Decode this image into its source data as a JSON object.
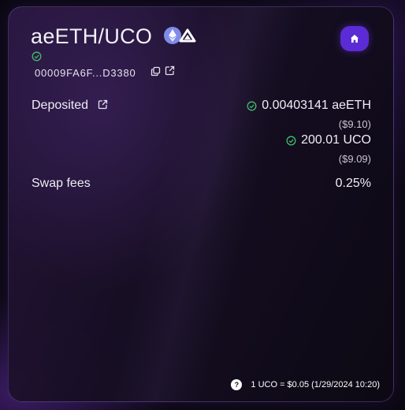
{
  "pool": {
    "title": "aeETH/UCO",
    "address": "00009FA6F...D3380",
    "token_icons": [
      "ethereum-icon",
      "archethic-uco-icon"
    ]
  },
  "nav": {
    "home_icon": "home-icon"
  },
  "deposited": {
    "label": "Deposited",
    "token1_amount": "0.00403141 aeETH",
    "token1_usd": "($9.10)",
    "token2_amount": "200.01 UCO",
    "token2_usd": "($9.09)"
  },
  "swap_fees": {
    "label": "Swap fees",
    "value": "0.25%"
  },
  "footer": {
    "help_symbol": "?",
    "price_text": "1 UCO = $0.05 (1/29/2024 10:20)"
  },
  "colors": {
    "accent": "#5b2bd6",
    "verified": "#3fbf6a",
    "eth": "#7e8be8"
  }
}
